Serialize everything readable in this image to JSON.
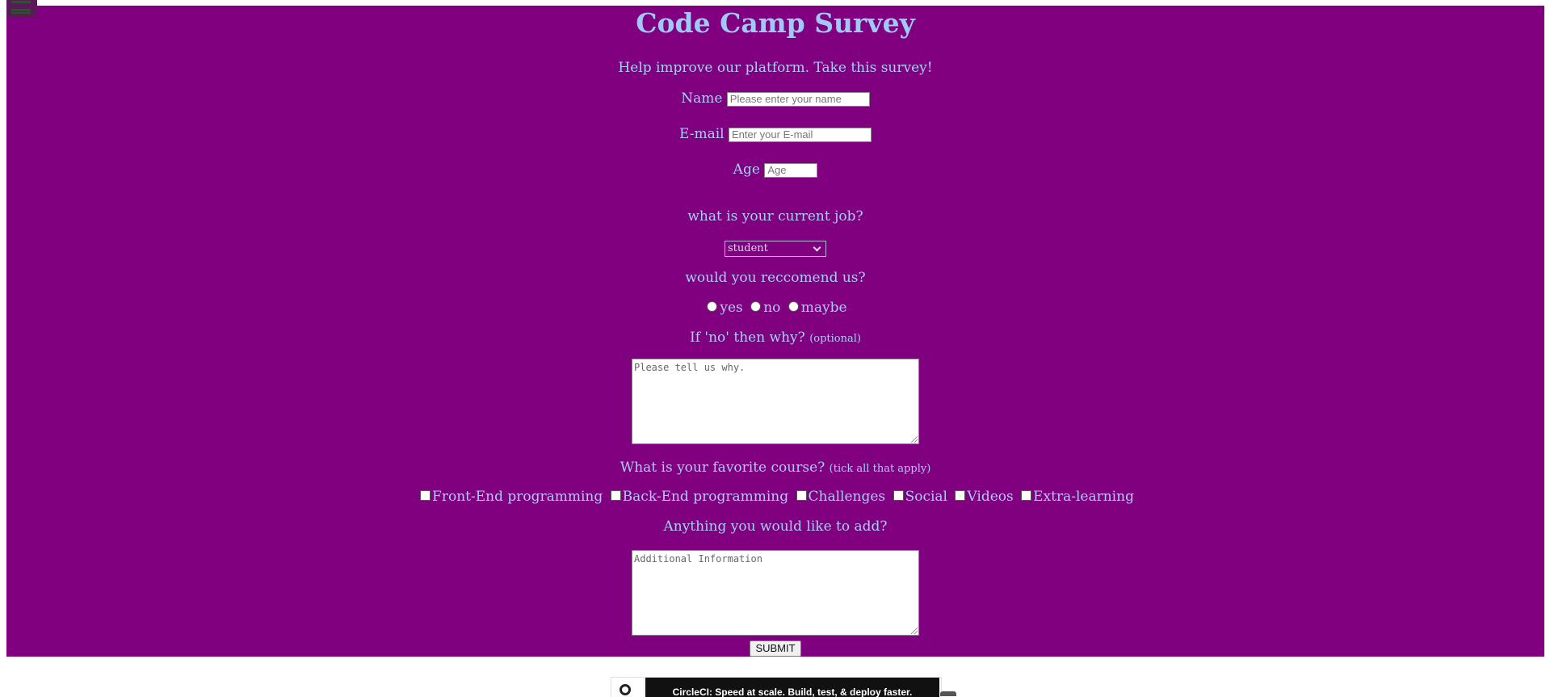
{
  "form": {
    "title": "Code Camp Survey",
    "description": "Help improve our platform. Take this survey!",
    "name_label": "Name",
    "name_placeholder": "Please enter your name",
    "email_label": "E-mail",
    "email_placeholder": "Enter your E-mail",
    "age_label": "Age",
    "age_placeholder": "Age",
    "job_question": "what is your current job?",
    "job_selected": "student",
    "recommend_question": "would you reccomend us?",
    "recommend_options": [
      "yes",
      "no",
      "maybe"
    ],
    "why_question": "If 'no' then why?",
    "why_note": "(optional)",
    "why_placeholder": "Please tell us why.",
    "course_question": "What is your favorite course?",
    "course_note": "(tick all that apply)",
    "course_options": [
      "Front-End programming",
      "Back-End programming",
      "Challenges",
      "Social",
      "Videos",
      "Extra-learning"
    ],
    "add_question": "Anything you would like to add?",
    "add_placeholder": "Additional Information",
    "submit_label": "SUBMIT"
  },
  "ad": {
    "text": "CircleCI: Speed at scale. Build, test, & deploy faster."
  },
  "colors": {
    "background": "#800080",
    "text": "#a9cdf5",
    "title": "#9ecaf5"
  },
  "icons": {
    "menu": "hamburger-menu-icon",
    "ad_logo": "circleci-logo-icon"
  }
}
